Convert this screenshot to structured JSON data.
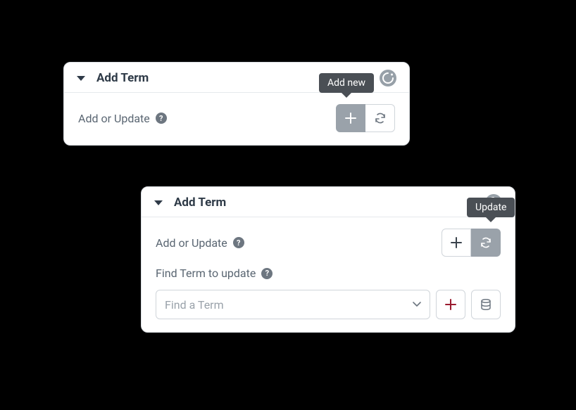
{
  "card1": {
    "title": "Add Term",
    "add_or_update_label": "Add or Update",
    "tooltip": "Add new"
  },
  "card2": {
    "title": "Add Term",
    "add_or_update_label": "Add or Update",
    "find_term_label": "Find Term to update",
    "select_placeholder": "Find a Term",
    "tooltip": "Update"
  },
  "icons": {
    "help_glyph": "?"
  }
}
